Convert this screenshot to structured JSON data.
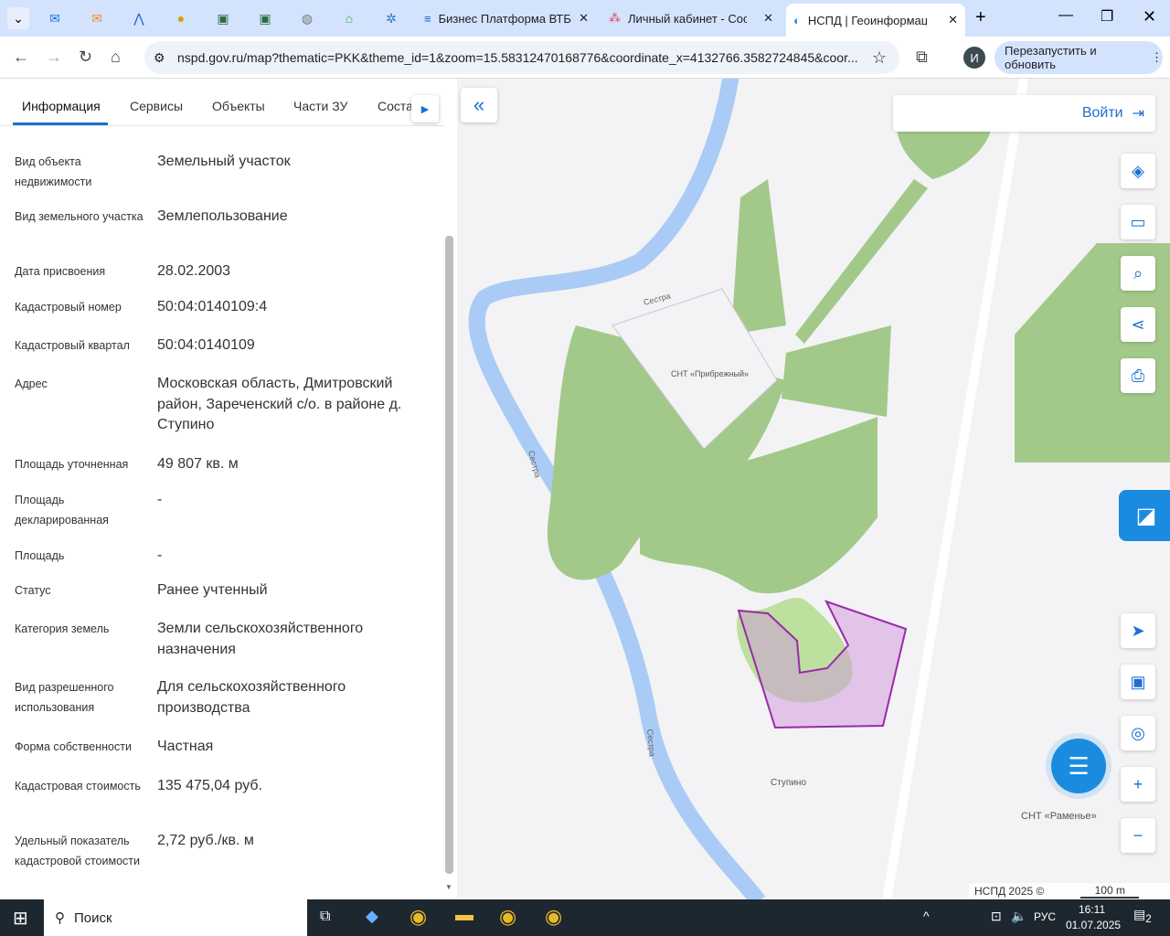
{
  "browser": {
    "tabs": [
      {
        "label": "Бизнес Платформа ВТБ"
      },
      {
        "label": "Личный кабинет - Сооб"
      },
      {
        "label": "НСПД | Геоинформацис",
        "active": true
      }
    ],
    "url": "nspd.gov.ru/map?thematic=PKK&theme_id=1&zoom=15.58312470168776&coordinate_x=4132766.3582724845&coor...",
    "profile_initial": "И",
    "restart_label": "Перезапустить и обновить"
  },
  "panel": {
    "tabs": [
      "Информация",
      "Сервисы",
      "Объекты",
      "Части ЗУ",
      "Соста"
    ],
    "rows": [
      {
        "label": "Вид объекта недвижимости",
        "value": "Земельный участок"
      },
      {
        "label": "Вид земельного участка",
        "value": "Землепользование"
      },
      {
        "label": "Дата присвоения",
        "value": "28.02.2003"
      },
      {
        "label": "Кадастровый номер",
        "value": "50:04:0140109:4"
      },
      {
        "label": "Кадастровый квартал",
        "value": "50:04:0140109"
      },
      {
        "label": "Адрес",
        "value": "Московская область, Дмитровский район, Зареченский с/о. в районе д. Ступино"
      },
      {
        "label": "Площадь уточненная",
        "value": "49 807 кв. м"
      },
      {
        "label": "Площадь декларированная",
        "value": "-"
      },
      {
        "label": "Площадь",
        "value": "-"
      },
      {
        "label": "Статус",
        "value": "Ранее учтенный"
      },
      {
        "label": "Категория земель",
        "value": "Земли сельскохозяйственного назначения"
      },
      {
        "label": "Вид разрешенного использования",
        "value": "Для сельскохозяйственного производства"
      },
      {
        "label": "Форма собственности",
        "value": "Частная"
      },
      {
        "label": "Кадастровая стоимость",
        "value": "135 475,04 руб."
      },
      {
        "label": "Удельный показатель кадастровой стоимости",
        "value": "2,72 руб./кв. м"
      }
    ]
  },
  "map": {
    "login_label": "Войти",
    "labels": {
      "river1": "Сестра",
      "river2": "Сестра",
      "river3": "Сестра",
      "snt1": "СНТ «Прибрежный»",
      "village": "Ступино",
      "snt2": "СНТ «Раменье»"
    },
    "attribution": "НСПД 2025 ©",
    "scale": "100 m"
  },
  "taskbar": {
    "search": "Поиск",
    "lang": "РУС",
    "time": "16:11",
    "date": "01.07.2025",
    "notifications": "2"
  }
}
